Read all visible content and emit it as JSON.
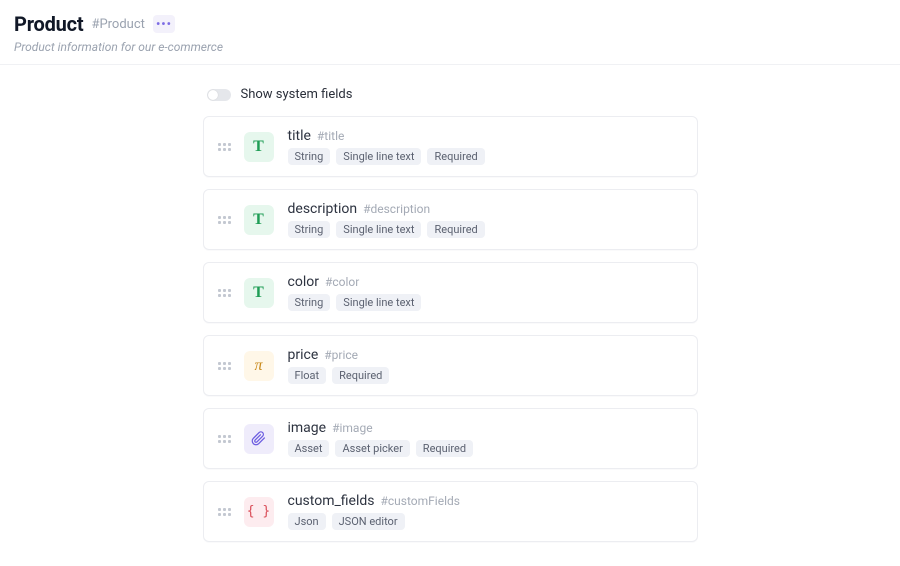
{
  "header": {
    "title": "Product",
    "api_id": "#Product",
    "subtitle": "Product information for our e-commerce"
  },
  "system_toggle": {
    "label": "Show system fields",
    "on": false
  },
  "icons": {
    "string": "T",
    "float": "π",
    "asset_svg": true,
    "json": "{ }"
  },
  "fields": [
    {
      "name": "title",
      "api_id": "#title",
      "type": "string",
      "badges": [
        "String",
        "Single line text",
        "Required"
      ]
    },
    {
      "name": "description",
      "api_id": "#description",
      "type": "string",
      "badges": [
        "String",
        "Single line text",
        "Required"
      ]
    },
    {
      "name": "color",
      "api_id": "#color",
      "type": "string",
      "badges": [
        "String",
        "Single line text"
      ]
    },
    {
      "name": "price",
      "api_id": "#price",
      "type": "float",
      "badges": [
        "Float",
        "Required"
      ]
    },
    {
      "name": "image",
      "api_id": "#image",
      "type": "asset",
      "badges": [
        "Asset",
        "Asset picker",
        "Required"
      ]
    },
    {
      "name": "custom_fields",
      "api_id": "#customFields",
      "type": "json",
      "badges": [
        "Json",
        "JSON editor"
      ]
    }
  ]
}
